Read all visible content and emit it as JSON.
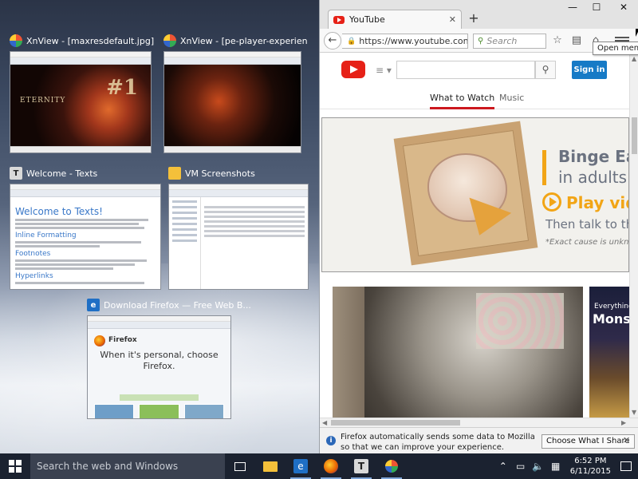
{
  "snap_tiles": [
    {
      "title": "XnView - [maxresdefault.jpg]",
      "thumb_tag": "#1",
      "thumb_caption": "ETERNITY"
    },
    {
      "title": "XnView - [pe-player-experien"
    },
    {
      "title": "Welcome - Texts",
      "icon_letter": "T",
      "doc_heading": "Welcome to Texts!",
      "doc_sub1": "Inline Formatting",
      "doc_sub2": "Footnotes",
      "doc_sub3": "Hyperlinks"
    },
    {
      "title": "VM Screenshots"
    },
    {
      "title": "Download Firefox — Free Web B...",
      "thumb_brand": "Firefox",
      "thumb_heading": "When it's personal, choose Firefox."
    }
  ],
  "browser": {
    "tab_title": "YouTube",
    "url": "https://www.youtube.con",
    "search_placeholder": "Search",
    "tooltip": "Open menu",
    "window_controls": {
      "minimize": "—",
      "maximize": "☐",
      "close": "✕"
    }
  },
  "youtube": {
    "signin_label": "Sign in",
    "tabs": [
      "What to Watch",
      "Music"
    ],
    "banner": {
      "line1": "Binge Ea",
      "line2": "in adults",
      "line3": "Play vid",
      "line4": "Then talk to the",
      "line5": "*Exact cause is unknow"
    },
    "video_side": {
      "small": "Everything",
      "big": "Monst"
    }
  },
  "infobar": {
    "message": "Firefox automatically sends some data to Mozilla so that we can improve your experience.",
    "button_label": "Choose What I Share"
  },
  "taskbar": {
    "search_placeholder": "Search the web and Windows",
    "time": "6:52 PM",
    "date": "6/11/2015"
  }
}
